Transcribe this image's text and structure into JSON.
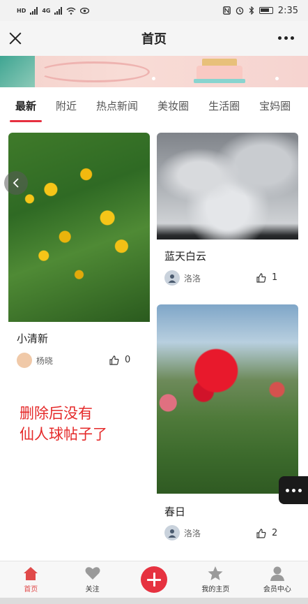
{
  "status_bar": {
    "left_badges": [
      "HD",
      "4G",
      "4G"
    ],
    "time": "2:35",
    "icons": [
      "signal-icon",
      "wifi-icon",
      "eye-icon",
      "nfc-icon",
      "alarm-icon",
      "bluetooth-icon",
      "battery-icon"
    ]
  },
  "header": {
    "title": "首页",
    "close_icon": "close-icon",
    "more_icon": "more-icon"
  },
  "tabs": [
    {
      "label": "最新",
      "active": true
    },
    {
      "label": "附近",
      "active": false
    },
    {
      "label": "热点新闻",
      "active": false
    },
    {
      "label": "美妆圈",
      "active": false
    },
    {
      "label": "生活圈",
      "active": false
    },
    {
      "label": "宝妈圈",
      "active": false
    }
  ],
  "posts": [
    {
      "title": "小清新",
      "author": "杨晓",
      "likes": "0"
    },
    {
      "title": "蓝天白云",
      "author": "洛洛",
      "likes": "1"
    },
    {
      "title": "春日",
      "author": "洛洛",
      "likes": "2"
    }
  ],
  "annotation": {
    "line1": "删除后没有",
    "line2": "仙人球帖子了"
  },
  "bottom_nav": [
    {
      "label": "首页",
      "icon": "home-icon",
      "active": true
    },
    {
      "label": "关注",
      "icon": "heart-icon",
      "active": false
    },
    {
      "label": "",
      "icon": "add-icon",
      "active": false
    },
    {
      "label": "我的主页",
      "icon": "star-icon",
      "active": false
    },
    {
      "label": "会员中心",
      "icon": "user-icon",
      "active": false
    }
  ],
  "colors": {
    "accent": "#e63240",
    "note": "#e52a2a",
    "nav_active": "#e04a4a"
  }
}
